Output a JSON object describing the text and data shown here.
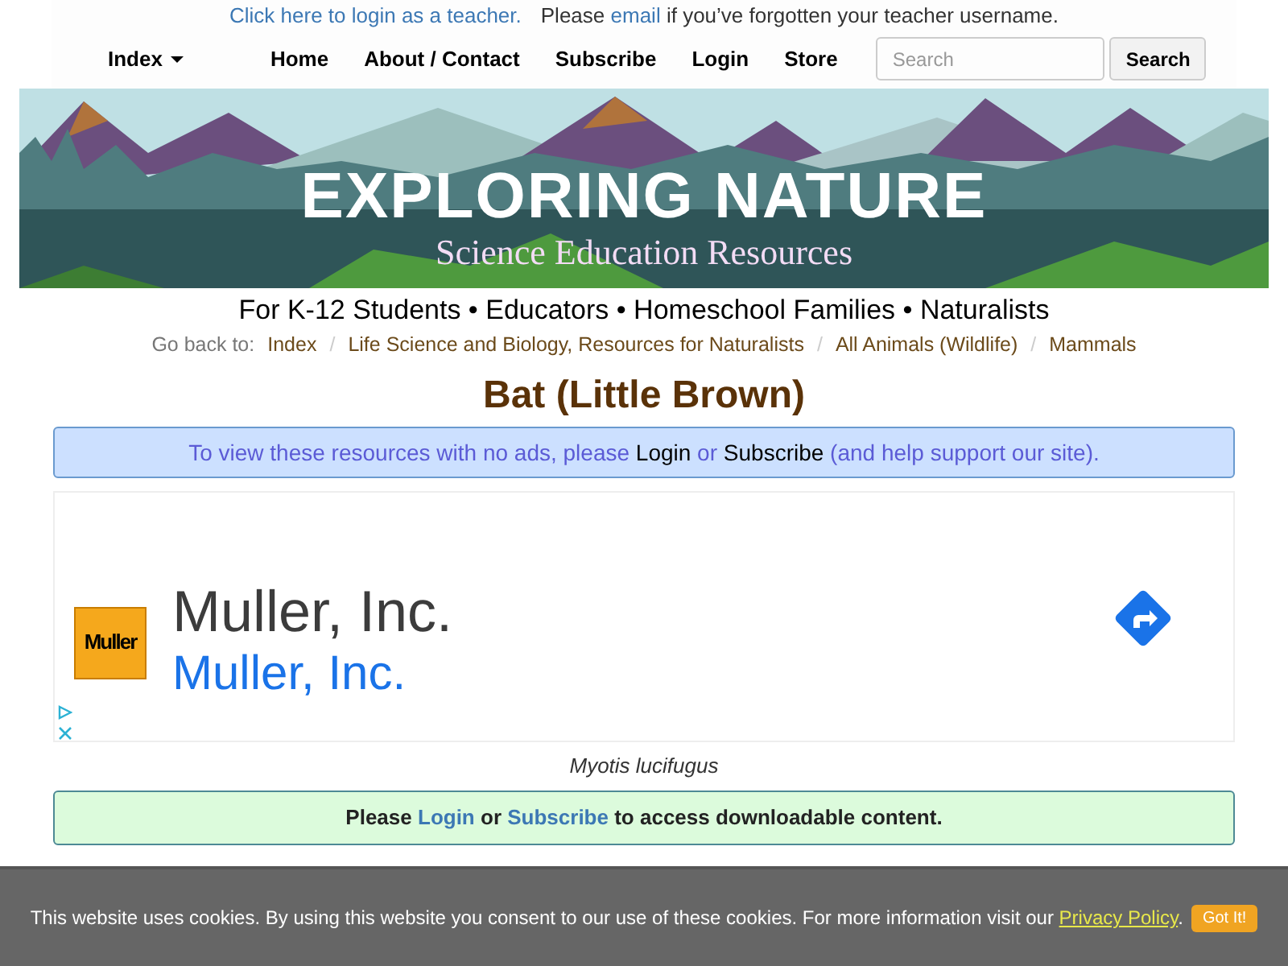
{
  "teacher_bar": {
    "login_link": "Click here to login as a teacher.",
    "message": [
      {
        "kind": "text",
        "text": "Please "
      },
      {
        "kind": "link",
        "text": "email"
      },
      {
        "kind": "text",
        "text": " if you’ve forgotten your teacher username."
      }
    ]
  },
  "nav": {
    "items": [
      {
        "label": "Index",
        "kind": "dropdown"
      },
      {
        "label": "Home",
        "kind": "link"
      },
      {
        "label": "About / Contact",
        "kind": "link"
      },
      {
        "label": "Subscribe",
        "kind": "link"
      },
      {
        "label": "Login",
        "kind": "link"
      },
      {
        "label": "Store",
        "kind": "link"
      }
    ],
    "search": {
      "placeholder": "Search"
    },
    "search_button": "Search"
  },
  "banner": {
    "title": "EXPLORING NATURE",
    "subtitle": "Science Education Resources"
  },
  "tagline": "For K-12 Students • Educators • Homeschool Families • Naturalists",
  "breadcrumb": {
    "label": "Go back to:",
    "separator": "/",
    "items": [
      "Index",
      "Life Science and Biology, Resources for Naturalists",
      "All Animals (Wildlife)",
      "Mammals"
    ]
  },
  "title": "Bat (Little Brown)",
  "ad_notice": [
    {
      "kind": "text",
      "text": "To view these resources with no ads, please "
    },
    {
      "kind": "link",
      "text": "Login"
    },
    {
      "kind": "text",
      "text": " or "
    },
    {
      "kind": "link",
      "text": "Subscribe"
    },
    {
      "kind": "text",
      "text": " (and help support our site)."
    }
  ],
  "ad": {
    "logo": "Muller",
    "headline": "Muller, Inc.",
    "link": "Muller, Inc."
  },
  "caption": "Myotis lucifugus",
  "download_notice": [
    {
      "kind": "text",
      "text": "Please "
    },
    {
      "kind": "link",
      "text": "Login"
    },
    {
      "kind": "text",
      "text": " or "
    },
    {
      "kind": "link",
      "text": "Subscribe"
    },
    {
      "kind": "text",
      "text": " to access downloadable content."
    }
  ],
  "cookie_bar": {
    "message": "This website uses cookies. By using this website you consent to our use of these cookies. For more information visit our ",
    "link": "Privacy Policy",
    "after": ".",
    "button": "Got It!"
  }
}
